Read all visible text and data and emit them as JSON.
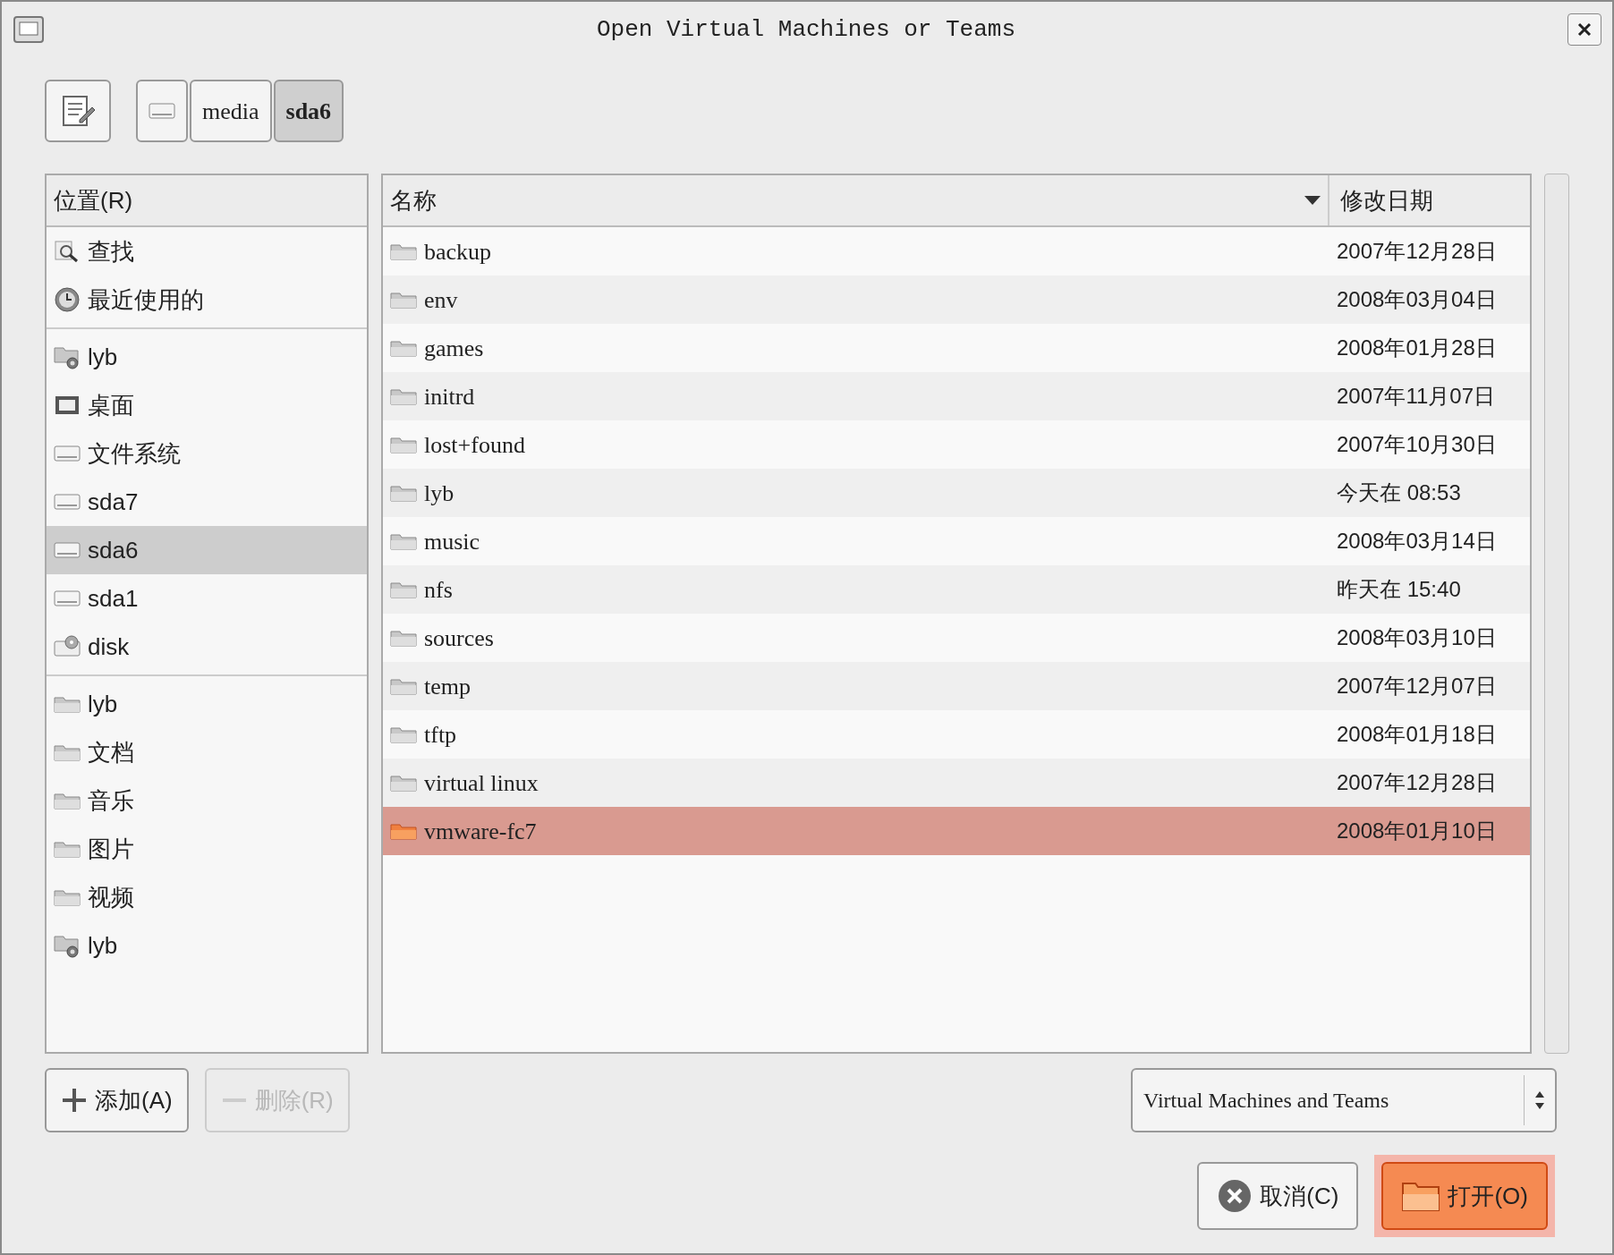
{
  "window": {
    "title": "Open Virtual Machines or Teams"
  },
  "path_bar": [
    {
      "kind": "drive",
      "selected": false
    },
    {
      "label": "media",
      "selected": false
    },
    {
      "label": "sda6",
      "selected": true
    }
  ],
  "sidebar": {
    "header": "位置(R)",
    "groups": [
      {
        "items": [
          {
            "kind": "search",
            "label": "查找",
            "selected": false
          },
          {
            "kind": "recent",
            "label": "最近使用的",
            "selected": false
          }
        ]
      },
      {
        "items": [
          {
            "kind": "home",
            "label": "lyb",
            "selected": false
          },
          {
            "kind": "desktop",
            "label": "桌面",
            "selected": false
          },
          {
            "kind": "drive",
            "label": "文件系统",
            "selected": false
          },
          {
            "kind": "drive",
            "label": "sda7",
            "selected": false
          },
          {
            "kind": "drive",
            "label": "sda6",
            "selected": true
          },
          {
            "kind": "drive",
            "label": "sda1",
            "selected": false
          },
          {
            "kind": "cdrom",
            "label": "disk",
            "selected": false
          }
        ]
      },
      {
        "items": [
          {
            "kind": "folder",
            "label": "lyb",
            "selected": false
          },
          {
            "kind": "folder",
            "label": "文档",
            "selected": false
          },
          {
            "kind": "folder",
            "label": "音乐",
            "selected": false
          },
          {
            "kind": "folder",
            "label": "图片",
            "selected": false
          },
          {
            "kind": "folder",
            "label": "视频",
            "selected": false
          },
          {
            "kind": "home",
            "label": "lyb",
            "selected": false
          }
        ]
      }
    ]
  },
  "file_list": {
    "columns": [
      "名称",
      "修改日期"
    ],
    "rows": [
      {
        "name": "backup",
        "date": "2007年12月28日",
        "selected": false
      },
      {
        "name": "env",
        "date": "2008年03月04日",
        "selected": false
      },
      {
        "name": "games",
        "date": "2008年01月28日",
        "selected": false
      },
      {
        "name": "initrd",
        "date": "2007年11月07日",
        "selected": false
      },
      {
        "name": "lost+found",
        "date": "2007年10月30日",
        "selected": false
      },
      {
        "name": "lyb",
        "date": "今天在 08:53",
        "selected": false
      },
      {
        "name": "music",
        "date": "2008年03月14日",
        "selected": false
      },
      {
        "name": "nfs",
        "date": "昨天在 15:40",
        "selected": false
      },
      {
        "name": "sources",
        "date": "2008年03月10日",
        "selected": false
      },
      {
        "name": "temp",
        "date": "2007年12月07日",
        "selected": false
      },
      {
        "name": "tftp",
        "date": "2008年01月18日",
        "selected": false
      },
      {
        "name": "virtual linux",
        "date": "2007年12月28日",
        "selected": false
      },
      {
        "name": "vmware-fc7",
        "date": "2008年01月10日",
        "selected": true
      }
    ]
  },
  "sidebar_buttons": [
    {
      "kind": "add",
      "label": "添加(A)",
      "disabled": false
    },
    {
      "kind": "remove",
      "label": "删除(R)",
      "disabled": true
    }
  ],
  "filter": {
    "value": "Virtual Machines and Teams"
  },
  "buttons": [
    {
      "kind": "cancel",
      "label": "取消(C)",
      "default": false
    },
    {
      "kind": "open",
      "label": "打开(O)",
      "default": true
    }
  ]
}
